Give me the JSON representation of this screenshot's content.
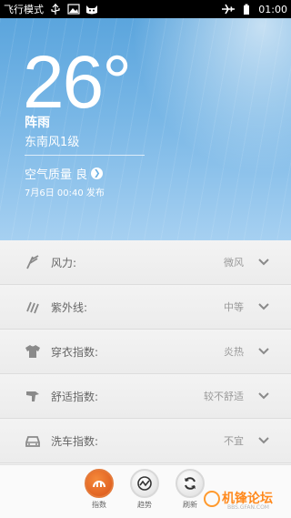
{
  "status_bar": {
    "mode_label": "飞行模式",
    "time": "01:00",
    "icons": [
      "usb-icon",
      "image-icon",
      "cat-icon",
      "airplane-icon",
      "battery-icon"
    ]
  },
  "weather": {
    "temperature": "26°",
    "condition": "阵雨",
    "wind": "东南风1级",
    "air_quality_label": "空气质量 良",
    "updated": "7月6日 00:40 发布"
  },
  "indices": [
    {
      "icon": "wind-icon",
      "label": "风力:",
      "value": "微风"
    },
    {
      "icon": "uv-icon",
      "label": "紫外线:",
      "value": "中等"
    },
    {
      "icon": "shirt-icon",
      "label": "穿衣指数:",
      "value": "炎热"
    },
    {
      "icon": "comfort-icon",
      "label": "舒适指数:",
      "value": "较不舒适"
    },
    {
      "icon": "car-icon",
      "label": "洗车指数:",
      "value": "不宜"
    }
  ],
  "bottom_nav": [
    {
      "icon": "index-icon",
      "label": "指数",
      "active": true
    },
    {
      "icon": "trend-icon",
      "label": "趋势",
      "active": false
    },
    {
      "icon": "refresh-icon",
      "label": "刷新",
      "active": false
    }
  ],
  "watermark": {
    "title": "机锋论坛",
    "sub": "BBS.GFAN.COM"
  },
  "colors": {
    "sky_top": "#5ba5dd",
    "sky_bottom": "#a6d0f1",
    "accent": "#e2661f",
    "watermark": "#ff8a1e"
  }
}
